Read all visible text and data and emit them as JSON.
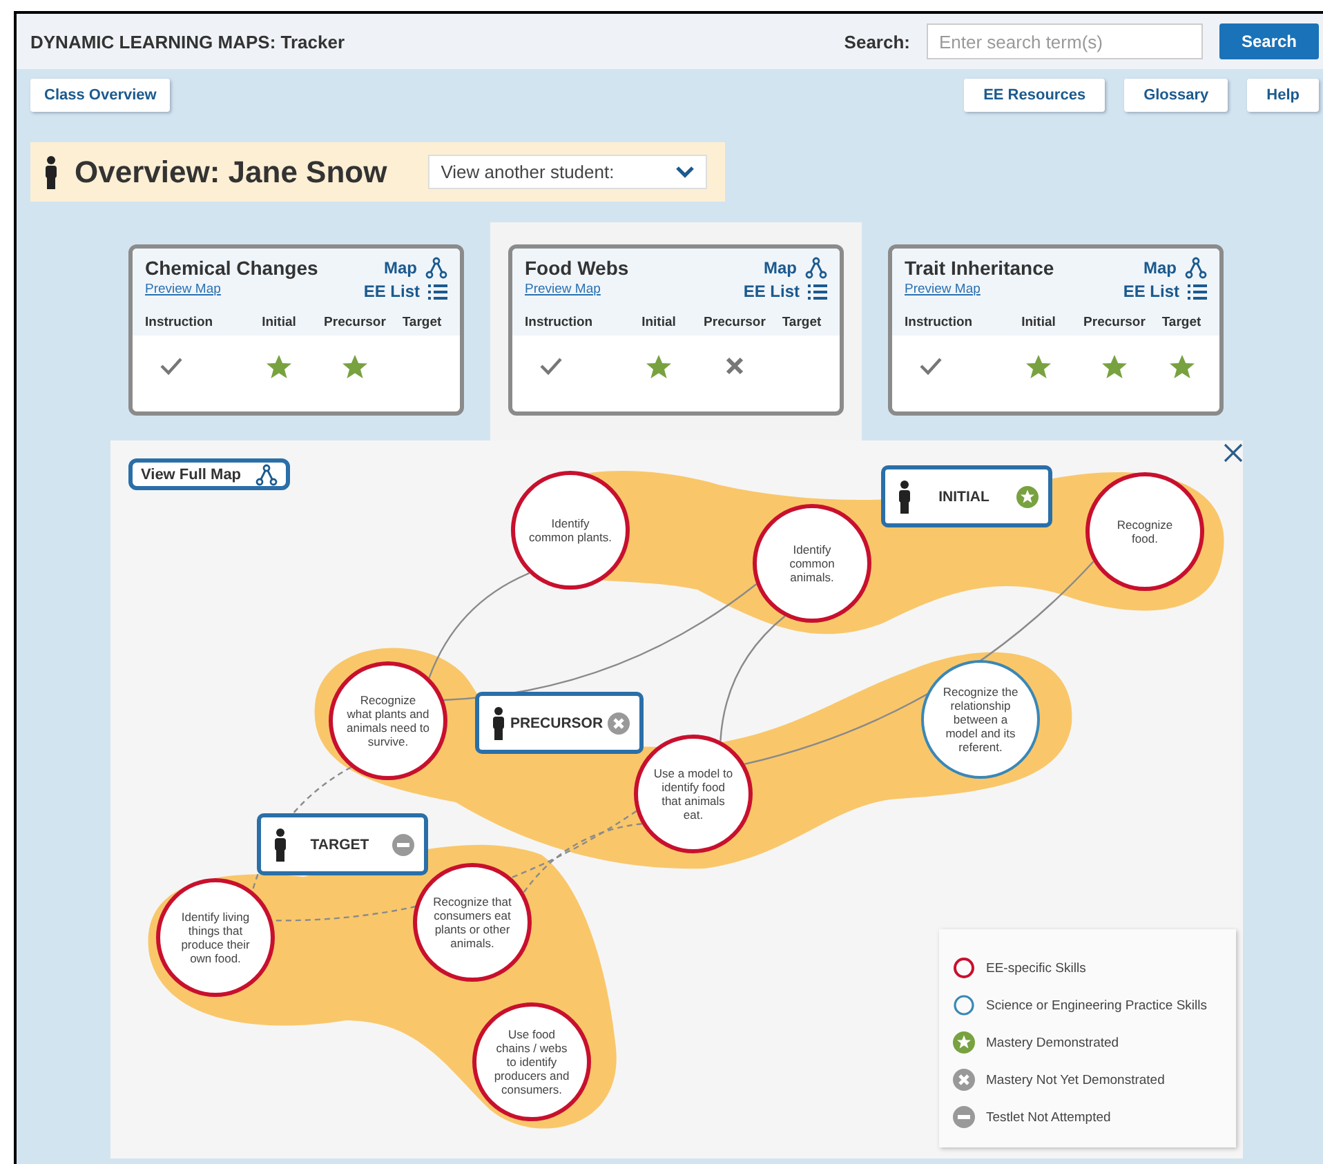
{
  "header": {
    "title": "DYNAMIC LEARNING MAPS: Tracker",
    "search_label": "Search:",
    "search": {
      "placeholder": "Enter search term(s)"
    },
    "search_button": "Search"
  },
  "nav": {
    "left": [
      "Class Overview"
    ],
    "right": [
      "EE Resources",
      "Glossary",
      "Help"
    ]
  },
  "overview": {
    "title": "Overview: Jane Snow",
    "dropdown": "View another student:"
  },
  "cards": [
    {
      "title": "Chemical Changes",
      "selected": false,
      "map_link": "Map",
      "preview_link": "Preview Map",
      "ee_list": "EE List",
      "steps": [
        {
          "label": "Instruction",
          "kind": "check"
        },
        {
          "label": "Initial",
          "kind": "star"
        },
        {
          "label": "Precursor",
          "kind": "star"
        },
        {
          "label": "Target",
          "kind": "none"
        }
      ]
    },
    {
      "title": "Food Webs",
      "selected": true,
      "map_link": "Map",
      "preview_link": "Preview Map",
      "ee_list": "EE List",
      "steps": [
        {
          "label": "Instruction",
          "kind": "check"
        },
        {
          "label": "Initial",
          "kind": "star"
        },
        {
          "label": "Precursor",
          "kind": "cross"
        },
        {
          "label": "Target",
          "kind": "none"
        }
      ]
    },
    {
      "title": "Trait Inheritance",
      "selected": false,
      "map_link": "Map",
      "preview_link": "Preview Map",
      "ee_list": "EE List",
      "steps": [
        {
          "label": "Instruction",
          "kind": "check"
        },
        {
          "label": "Initial",
          "kind": "star"
        },
        {
          "label": "Precursor",
          "kind": "star"
        },
        {
          "label": "Target",
          "kind": "star"
        }
      ]
    }
  ],
  "map": {
    "view_full_map": "View Full Map",
    "nodes": [
      {
        "text": "Identify common plants.",
        "kind": "ee"
      },
      {
        "text": "Identify common animals.",
        "kind": "ee"
      },
      {
        "text": "Recognize food.",
        "kind": "ee"
      },
      {
        "text": "Recognize what plants and animals need to survive.",
        "kind": "ee"
      },
      {
        "text": "Use a model to identify food that animals eat.",
        "kind": "ee"
      },
      {
        "text": "Recognize the relationship between a model and its referent.",
        "kind": "practice"
      },
      {
        "text": "Identify living things that produce their own food.",
        "kind": "ee"
      },
      {
        "text": "Recognize that consumers eat plants or other animals.",
        "kind": "ee"
      },
      {
        "text": "Use food chains / webs to identify producers and consumers.",
        "kind": "ee"
      }
    ],
    "badges": [
      {
        "label": "INITIAL",
        "kind": "mastered"
      },
      {
        "label": "PRECURSOR",
        "kind": "not_yet"
      },
      {
        "label": "TARGET",
        "kind": "not_attempted"
      }
    ],
    "legend": [
      {
        "kind": "ee",
        "label": "EE-specific Skills"
      },
      {
        "kind": "practice",
        "label": "Science or Engineering Practice Skills"
      },
      {
        "kind": "mastered",
        "label": "Mastery Demonstrated"
      },
      {
        "kind": "not_yet",
        "label": "Mastery Not Yet Demonstrated"
      },
      {
        "kind": "not_attempted",
        "label": "Testlet Not Attempted"
      }
    ]
  }
}
